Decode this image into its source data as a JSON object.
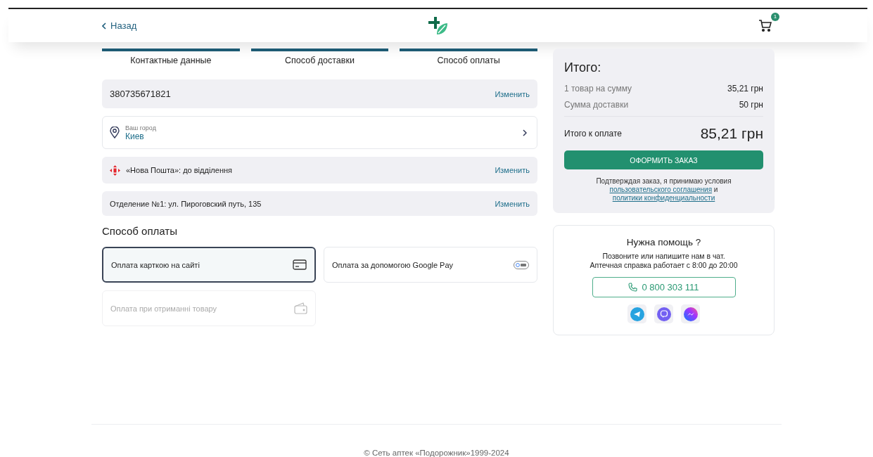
{
  "header": {
    "back": "Назад",
    "cart_count": "1"
  },
  "steps": [
    {
      "label": "Контактные данные",
      "done": true
    },
    {
      "label": "Способ доставки",
      "done": true
    },
    {
      "label": "Способ оплаты",
      "done": true
    }
  ],
  "contact": {
    "phone": "380735671821",
    "action": "Изменить"
  },
  "city": {
    "label": "Ваш город",
    "value": "Киев"
  },
  "delivery": {
    "method": "«Нова Пошта»: до відділення",
    "action": "Изменить"
  },
  "branch": {
    "address": "Отделение №1: ул. Пироговский путь, 135",
    "action": "Изменить"
  },
  "payment": {
    "title": "Способ оплаты",
    "options": [
      {
        "label": "Оплата карткою на сайті",
        "kind": "card",
        "selected": true,
        "disabled": false
      },
      {
        "label": "Оплата за допомогою Google Pay",
        "kind": "gpay",
        "selected": false,
        "disabled": false
      },
      {
        "label": "Оплата при отриманні товару",
        "kind": "wallet",
        "selected": false,
        "disabled": true
      }
    ]
  },
  "summary": {
    "title": "Итого:",
    "lines": [
      {
        "label": "1 товар на сумму",
        "value": "35,21 грн"
      },
      {
        "label": "Сумма доставки",
        "value": "50 грн"
      }
    ],
    "total_label": "Итого к оплате",
    "total": "85,21 грн",
    "submit": "ОФОРМИТЬ ЗАКАЗ",
    "terms": "Подтверждая заказ, я принимаю условия",
    "link_1": "пользовательского соглашения",
    "joiner": "и",
    "link_2": "политики конфиденциальности"
  },
  "help": {
    "title": "Нужна помощь ?",
    "line_1": "Позвоните или напишите нам в чат.",
    "line_2": "Аптечная справка работает с 8:00 до 20:00",
    "phone": "0 800 303 111",
    "messengers": [
      {
        "kind": "telegram"
      },
      {
        "kind": "viber"
      },
      {
        "kind": "messenger"
      }
    ]
  },
  "footer": "© Сеть аптек «Подорожник»1999-2024"
}
